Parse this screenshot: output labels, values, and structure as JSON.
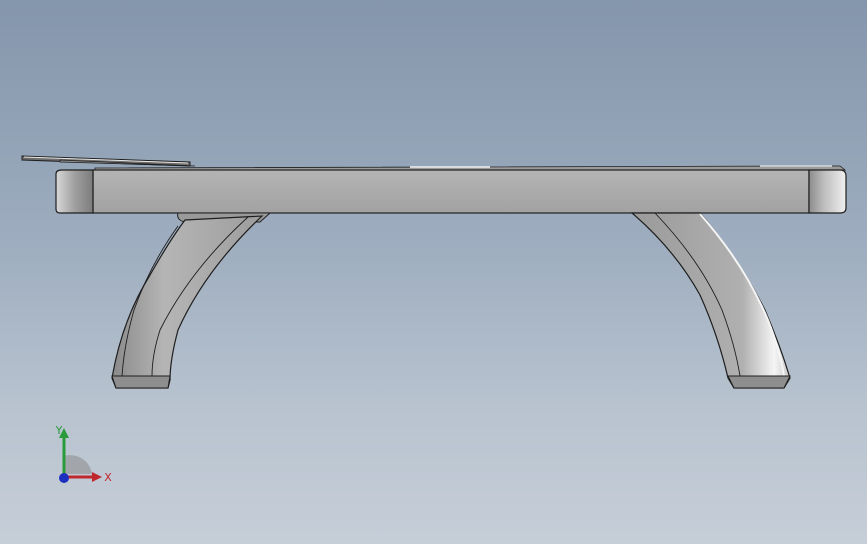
{
  "viewport": {
    "background_top": "#8496ac",
    "background_bottom": "#c6ced8"
  },
  "model": {
    "part_color": "#a9a9a9",
    "highlight_color": "#f2f2f2",
    "edge_color": "#1e1e1e"
  },
  "triad": {
    "x_label": "X",
    "y_label": "Y",
    "x_color": "#c0282d",
    "y_color": "#2a9a3a",
    "z_color": "#1d2fbf"
  }
}
